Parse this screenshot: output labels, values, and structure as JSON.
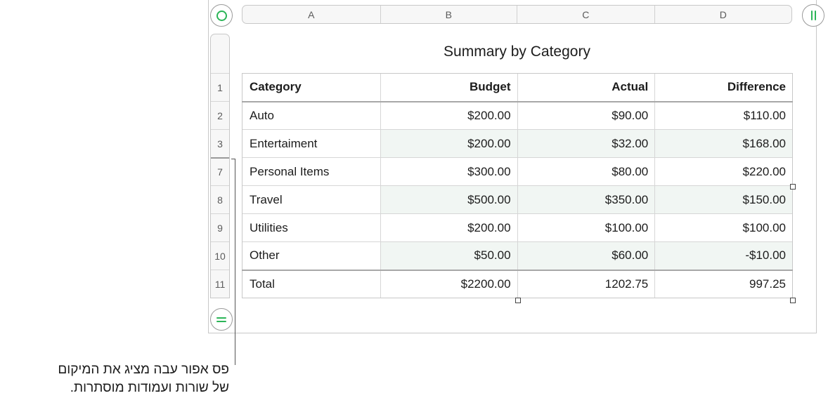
{
  "columns": [
    "A",
    "B",
    "C",
    "D"
  ],
  "row_numbers": [
    "1",
    "2",
    "3",
    "7",
    "8",
    "9",
    "10",
    "11"
  ],
  "table": {
    "title": "Summary by Category",
    "headers": [
      "Category",
      "Budget",
      "Actual",
      "Difference"
    ],
    "rows": [
      [
        "Auto",
        "$200.00",
        "$90.00",
        "$110.00"
      ],
      [
        "Entertaiment",
        "$200.00",
        "$32.00",
        "$168.00"
      ],
      [
        "Personal Items",
        "$300.00",
        "$80.00",
        "$220.00"
      ],
      [
        "Travel",
        "$500.00",
        "$350.00",
        "$150.00"
      ],
      [
        "Utilities",
        "$200.00",
        "$100.00",
        "$100.00"
      ],
      [
        "Other",
        "$50.00",
        "$60.00",
        "-$10.00"
      ]
    ],
    "footer": [
      "Total",
      "$2200.00",
      "1202.75",
      "997.25"
    ]
  },
  "callout": {
    "line1": "פס אפור עבה מציג את המיקום",
    "line2": "של שורות ועמודות מוסתרות."
  },
  "icons": {
    "select_all": "circle-icon",
    "column_toggle": "double-bar-icon",
    "row_toggle": "equal-icon"
  },
  "colors": {
    "accent": "#2bb557",
    "alt_row": "#f1f6f3",
    "hidden_marker": "#9a9a9a"
  }
}
